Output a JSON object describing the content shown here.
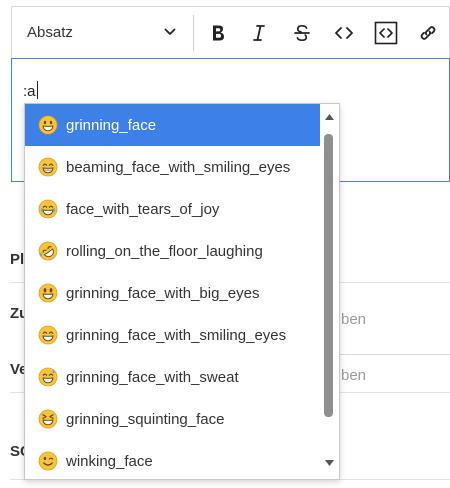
{
  "toolbar": {
    "format_select": {
      "value": "Absatz"
    },
    "buttons": [
      {
        "name": "bold",
        "icon": "bold-icon"
      },
      {
        "name": "italic",
        "icon": "italic-icon"
      },
      {
        "name": "strikethrough",
        "icon": "strikethrough-icon"
      },
      {
        "name": "inline-code",
        "icon": "code-icon"
      },
      {
        "name": "code-block",
        "icon": "code-block-icon"
      },
      {
        "name": "link",
        "icon": "link-icon"
      }
    ]
  },
  "editor": {
    "text": ":a"
  },
  "background": {
    "labels": [
      "Pl",
      "Zu",
      "Ve",
      "SC"
    ],
    "placeholders": [
      "ben",
      "ben"
    ]
  },
  "autocomplete": {
    "selected_index": 0,
    "accent_color": "#3d80e8",
    "items": [
      {
        "label": "grinning_face",
        "emoji": "grinning-face-icon"
      },
      {
        "label": "beaming_face_with_smiling_eyes",
        "emoji": "beaming-face-icon"
      },
      {
        "label": "face_with_tears_of_joy",
        "emoji": "tears-of-joy-icon"
      },
      {
        "label": "rolling_on_the_floor_laughing",
        "emoji": "rofl-icon"
      },
      {
        "label": "grinning_face_with_big_eyes",
        "emoji": "grinning-big-eyes-icon"
      },
      {
        "label": "grinning_face_with_smiling_eyes",
        "emoji": "grinning-smiling-eyes-icon"
      },
      {
        "label": "grinning_face_with_sweat",
        "emoji": "grinning-sweat-icon"
      },
      {
        "label": "grinning_squinting_face",
        "emoji": "squinting-face-icon"
      },
      {
        "label": "winking_face",
        "emoji": "winking-face-icon"
      }
    ]
  }
}
